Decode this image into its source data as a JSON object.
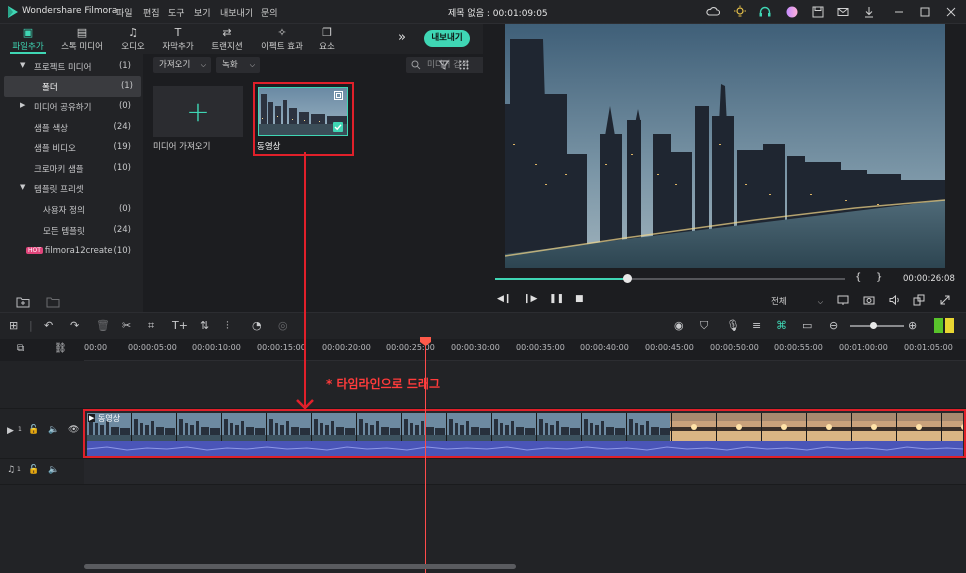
{
  "app": {
    "name": "Wondershare Filmora",
    "title": "제목 없음 : 00:01:09:05"
  },
  "menu": [
    "파일",
    "편집",
    "도구",
    "보기",
    "내보내기",
    "문의"
  ],
  "tabs": [
    {
      "label": "파일추가",
      "icon": "folder-icon",
      "active": true
    },
    {
      "label": "스톡 미디어",
      "icon": "stock-icon"
    },
    {
      "label": "오디오",
      "icon": "music-icon"
    },
    {
      "label": "자막추가",
      "icon": "text-icon"
    },
    {
      "label": "트랜지션",
      "icon": "transition-icon"
    },
    {
      "label": "이펙트 효과",
      "icon": "effects-icon"
    },
    {
      "label": "요소",
      "icon": "elements-icon"
    }
  ],
  "export_label": "내보내기",
  "sidebar": [
    {
      "label": "프로젝트 미디어",
      "count": "(1)",
      "arrow": "▼"
    },
    {
      "label": "폴더",
      "count": "(1)",
      "selected": true
    },
    {
      "label": "미디어 공유하기",
      "count": "(0)",
      "arrow": "▶"
    },
    {
      "label": "샘플 색상",
      "count": "(24)"
    },
    {
      "label": "샘플 비디오",
      "count": "(19)"
    },
    {
      "label": "크로마키 샘플",
      "count": "(10)"
    },
    {
      "label": "템플릿 프리셋",
      "count": "",
      "arrow": "▼"
    },
    {
      "label": "사용자 정의",
      "count": "(0)"
    },
    {
      "label": "모든 템플릿",
      "count": "(24)"
    },
    {
      "label": "filmora12create",
      "count": "(10)",
      "hot": "HOT"
    }
  ],
  "media": {
    "import_dropdown": "가져오기",
    "record_dropdown": "녹화",
    "search_placeholder": "미디어 검색",
    "import_caption": "미디어 가져오기",
    "clip_caption": "동영상"
  },
  "preview": {
    "timecode": "00:00:26:08",
    "quality": "전체",
    "progress": 0.377
  },
  "timeline": {
    "ruler": [
      "00:00",
      "00:00:05:00",
      "00:00:10:00",
      "00:00:15:00",
      "00:00:20:00",
      "00:00:25:00",
      "00:00:30:00",
      "00:00:35:00",
      "00:00:40:00",
      "00:00:45:00",
      "00:00:50:00",
      "00:00:55:00",
      "00:01:00:00",
      "00:01:05:00"
    ],
    "clip_label": "동영상",
    "video_track_num": "1",
    "audio_track_num": "1",
    "annotation": "* 타임라인으로 드래그"
  },
  "colors": {
    "accent": "#3fd6b4",
    "annotation": "#e0202a",
    "playhead": "#ff4b4b"
  }
}
